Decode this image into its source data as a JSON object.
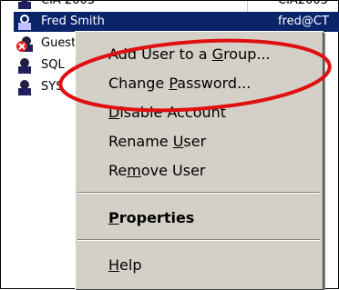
{
  "list": {
    "rows": [
      {
        "name": "CIA 2003",
        "login": "CIA2003"
      },
      {
        "name": "Fred Smith",
        "login": "fred@CT"
      },
      {
        "name": "Guest",
        "login": ""
      },
      {
        "name": "SQL",
        "login": ""
      },
      {
        "name": "SYS",
        "login": ""
      }
    ]
  },
  "menu": {
    "items": [
      {
        "pre": "Add User to a ",
        "acc": "G",
        "post": "roup..."
      },
      {
        "pre": "Change ",
        "acc": "P",
        "post": "assword..."
      },
      {
        "pre": "",
        "acc": "D",
        "post": "isable Account"
      },
      {
        "pre": "Rename ",
        "acc": "U",
        "post": "ser"
      },
      {
        "pre": "Re",
        "acc": "m",
        "post": "ove User"
      },
      {
        "pre": "",
        "acc": "P",
        "post": "roperties"
      },
      {
        "pre": "",
        "acc": "H",
        "post": "elp"
      }
    ]
  },
  "colors": {
    "selection": "#0a246a",
    "highlight_ellipse": "#e01010",
    "menu_bg": "#d4d0c8"
  },
  "icons": [
    "user-icon",
    "disabled-user-icon"
  ]
}
